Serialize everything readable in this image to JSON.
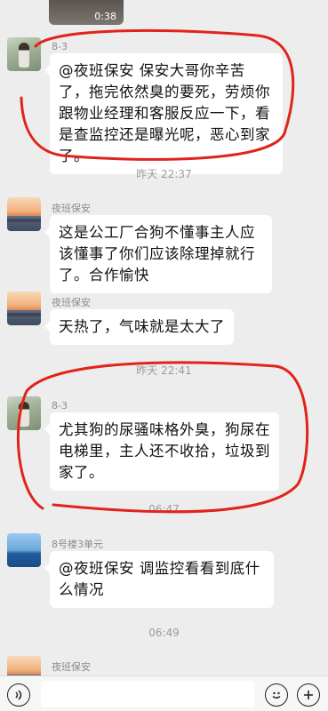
{
  "top_video": {
    "duration": "0:38"
  },
  "messages": [
    {
      "sender": "8-3",
      "avatar": "girl-avatar",
      "text": "@夜班保安 保安大哥你辛苦了，拖完依然臭的要死，劳烦你跟物业经理和客服反应一下，看是查监控还是曝光呢，恶心到家了。"
    },
    {
      "sender": "夜班保安",
      "avatar": "sunset-avatar",
      "text": "这是公工厂合狗不懂事主人应该懂事了你们应该除理掉就行了。合作愉快"
    },
    {
      "sender": "夜班保安",
      "avatar": "sunset-avatar",
      "text": "天热了，气味就是太大了"
    },
    {
      "sender": "8-3",
      "avatar": "girl-avatar",
      "text": "尤其狗的尿骚味格外臭，狗尿在电梯里，主人还不收拾，垃圾到家了。"
    },
    {
      "sender": "8号楼3单元",
      "avatar": "sea-avatar",
      "text": "@夜班保安 调监控看看到底什么情况"
    },
    {
      "sender": "夜班保安",
      "avatar": "sunset-avatar",
      "text": ""
    }
  ],
  "timestamps": [
    "昨天 22:37",
    "昨天 22:41",
    "06:47",
    "06:49"
  ],
  "colors": {
    "annotation_red": "#e0241a",
    "bubble": "#ffffff",
    "background": "#ededed"
  },
  "bottom_bar": {
    "voice_icon": "voice-icon",
    "emoji_icon": "emoji-icon",
    "plus_icon": "plus-icon"
  }
}
